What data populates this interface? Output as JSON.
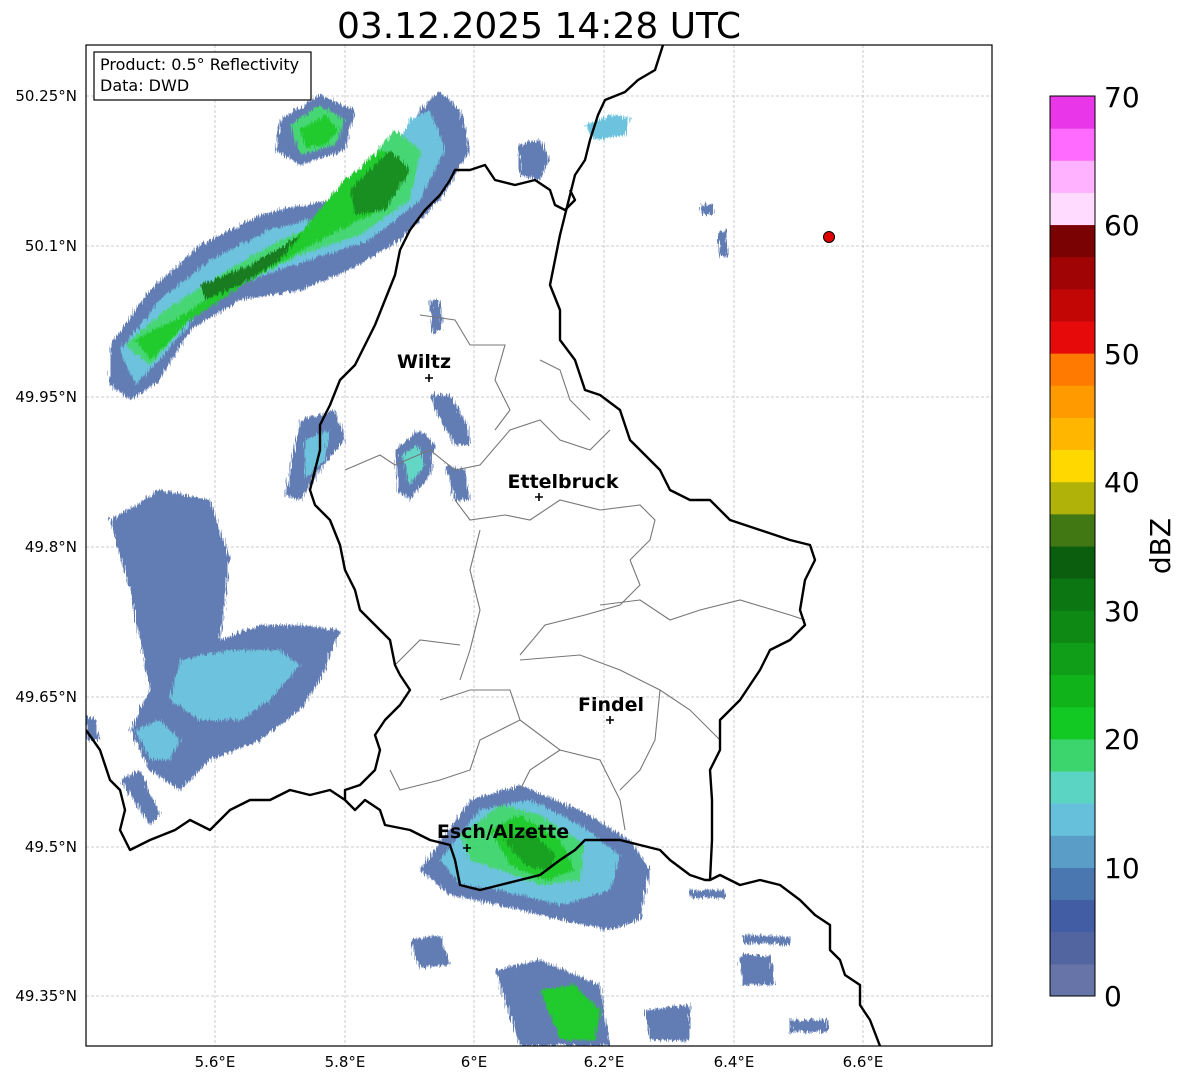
{
  "title": "03.12.2025 14:28 UTC",
  "info": {
    "product": "Product: 0.5° Reflectivity",
    "source": "Data: DWD"
  },
  "axes": {
    "lon_ticks": [
      "5.6°E",
      "5.8°E",
      "6°E",
      "6.2°E",
      "6.4°E",
      "6.6°E"
    ],
    "lat_ticks": [
      "50.25°N",
      "50.1°N",
      "49.95°N",
      "49.8°N",
      "49.65°N",
      "49.5°N",
      "49.35°N"
    ]
  },
  "cities": [
    {
      "name": "Wiltz"
    },
    {
      "name": "Ettelbruck"
    },
    {
      "name": "Findel"
    },
    {
      "name": "Esch/Alzette"
    }
  ],
  "colorbar": {
    "label": "dBZ",
    "ticks": [
      "0",
      "10",
      "20",
      "30",
      "40",
      "50",
      "60",
      "70"
    ],
    "colors": [
      "#6674a8",
      "#5265a0",
      "#425da4",
      "#4a77b0",
      "#5a9ec8",
      "#66c0dc",
      "#5cd4c4",
      "#3cd46c",
      "#12c822",
      "#10b41a",
      "#109e18",
      "#0e8a14",
      "#0c7612",
      "#0a5e0e",
      "#427814",
      "#b0b20a",
      "#ffd800",
      "#ffb600",
      "#ff9a00",
      "#ff7a00",
      "#e60a0a",
      "#c20606",
      "#a00404",
      "#7a0202",
      "#ffdcff",
      "#ffb2ff",
      "#ff6aff",
      "#e836e8"
    ]
  },
  "marker": {
    "color": "#e00000"
  }
}
